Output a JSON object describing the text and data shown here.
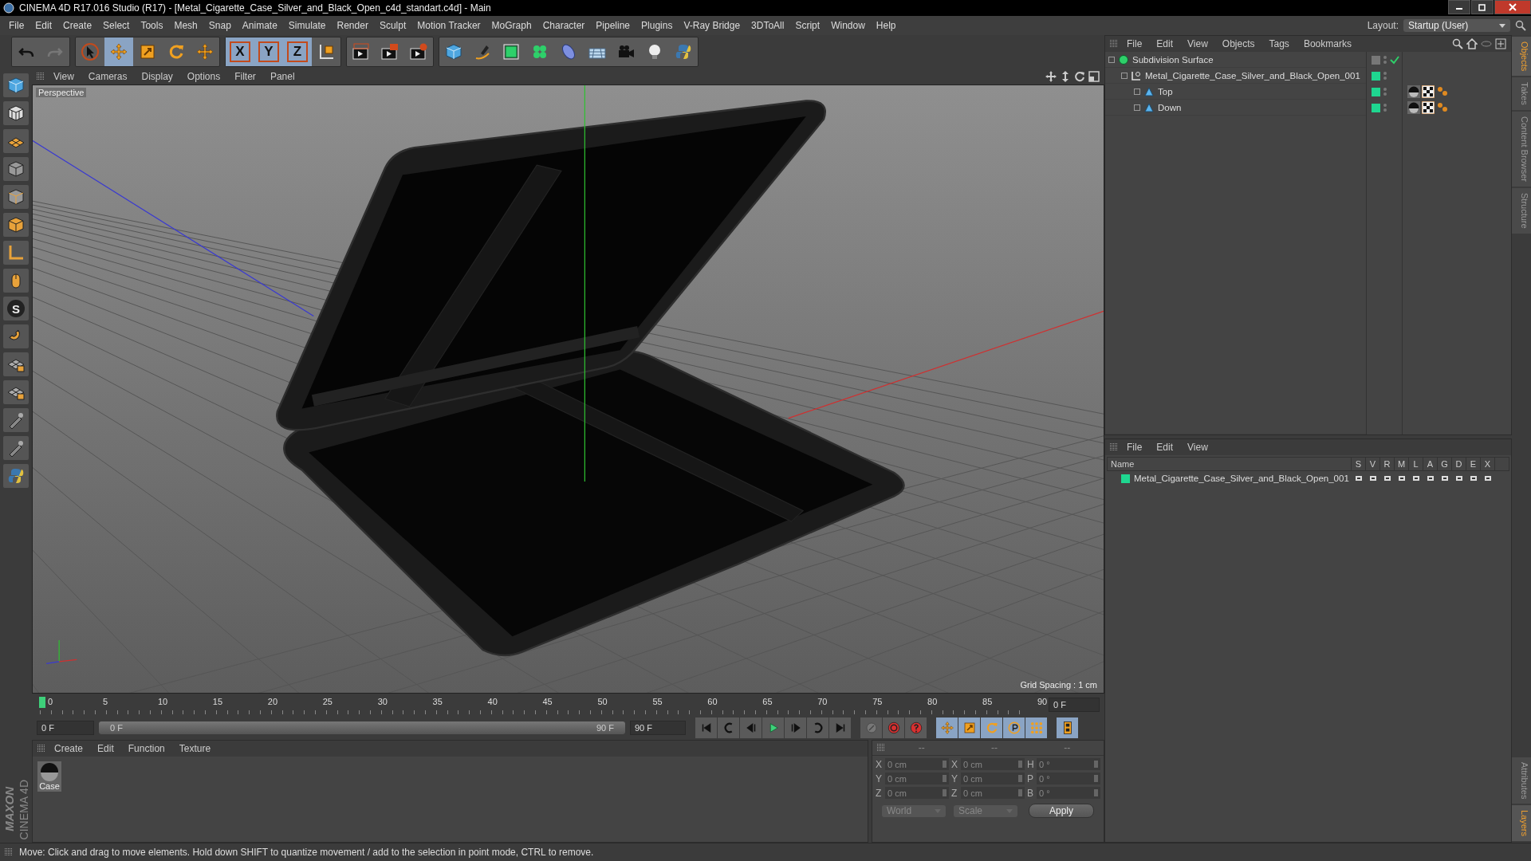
{
  "window": {
    "title": "CINEMA 4D R17.016 Studio (R17) - [Metal_Cigarette_Case_Silver_and_Black_Open_c4d_standart.c4d] - Main"
  },
  "menu_bar": [
    "File",
    "Edit",
    "Create",
    "Select",
    "Tools",
    "Mesh",
    "Snap",
    "Animate",
    "Simulate",
    "Render",
    "Sculpt",
    "Motion Tracker",
    "MoGraph",
    "Character",
    "Pipeline",
    "Plugins",
    "V-Ray Bridge",
    "3DToAll",
    "Script",
    "Window",
    "Help"
  ],
  "layout": {
    "label": "Layout:",
    "value": "Startup (User)"
  },
  "toolbar": {
    "tools": [
      {
        "selected": false
      },
      {
        "selected": true
      },
      {
        "selected": false
      },
      {
        "selected": false
      },
      {
        "selected": false
      }
    ],
    "axes": [
      {
        "label": "X",
        "selected": true
      },
      {
        "label": "Y",
        "selected": true
      },
      {
        "label": "Z",
        "selected": true
      }
    ]
  },
  "left_toolbar": {
    "snap_label": "S"
  },
  "viewport": {
    "menu": [
      "View",
      "Cameras",
      "Display",
      "Options",
      "Filter",
      "Panel"
    ],
    "camera": "Perspective",
    "grid_spacing": "Grid Spacing : 1 cm"
  },
  "timeline": {
    "ticks": [
      "0",
      "5",
      "10",
      "15",
      "20",
      "25",
      "30",
      "35",
      "40",
      "45",
      "50",
      "55",
      "60",
      "65",
      "70",
      "75",
      "80",
      "85",
      "90"
    ],
    "playhead": {
      "level": 0
    },
    "current_frame": "0 F",
    "start_field": "0 F",
    "range_start": "0 F",
    "range_end": "90 F",
    "range": {
      "level": 1
    },
    "end_field": "90 F"
  },
  "materials": {
    "menu": [
      "Create",
      "Edit",
      "Function",
      "Texture"
    ],
    "items": [
      {
        "name": "Case"
      }
    ]
  },
  "coordinates": {
    "headers": [
      "--",
      "--",
      "--"
    ],
    "rows": [
      {
        "axis": "X",
        "position": "0 cm",
        "size_axis": "X",
        "size": "0 cm",
        "rot_axis": "H",
        "rotation": "0 °"
      },
      {
        "axis": "Y",
        "position": "0 cm",
        "size_axis": "Y",
        "size": "0 cm",
        "rot_axis": "P",
        "rotation": "0 °"
      },
      {
        "axis": "Z",
        "position": "0 cm",
        "size_axis": "Z",
        "size": "0 cm",
        "rot_axis": "B",
        "rotation": "0 °"
      }
    ],
    "mode": "World",
    "scale_mode": "Scale",
    "apply": "Apply"
  },
  "objects": {
    "menu": [
      "File",
      "Edit",
      "View",
      "Objects",
      "Tags",
      "Bookmarks"
    ],
    "tree": [
      {
        "name": "Subdivision Surface",
        "kind": "subdivision",
        "enabled": true,
        "has_material": false,
        "children": [
          {
            "name": "Metal_Cigarette_Case_Silver_and_Black_Open_001",
            "kind": "null",
            "has_material": false,
            "children": [
              {
                "name": "Top",
                "kind": "polygon",
                "has_material": true
              },
              {
                "name": "Down",
                "kind": "polygon",
                "has_material": true
              }
            ]
          }
        ]
      }
    ]
  },
  "layers": {
    "menu": [
      "File",
      "Edit",
      "View"
    ],
    "columns": [
      "Name",
      "S",
      "V",
      "R",
      "M",
      "L",
      "A",
      "G",
      "D",
      "E",
      "X"
    ],
    "rows": [
      {
        "name": "Metal_Cigarette_Case_Silver_and_Black_Open_001",
        "color": "#1fd690"
      }
    ]
  },
  "side_tabs": [
    {
      "label": "Objects",
      "selected": true
    },
    {
      "label": "Takes",
      "selected": false
    },
    {
      "label": "Content Browser",
      "selected": false
    },
    {
      "label": "Structure",
      "selected": false
    }
  ],
  "side_tabs_lower": [
    {
      "label": "Attributes",
      "selected": false
    },
    {
      "label": "Layers",
      "selected": true
    }
  ],
  "logo": {
    "brand": "MAXON",
    "product": "CINEMA 4D"
  },
  "status_bar": "Move: Click and drag to move elements. Hold down SHIFT to quantize movement / add to the selection in point mode, CTRL to remove."
}
